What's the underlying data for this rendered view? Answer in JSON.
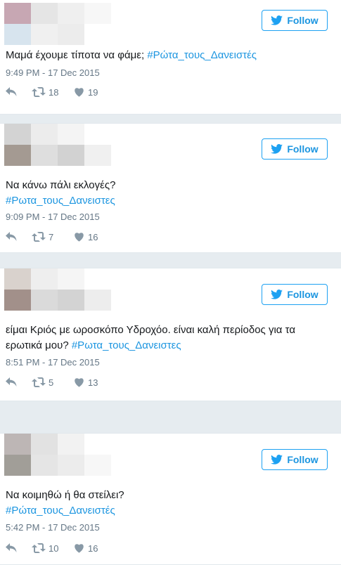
{
  "colors": {
    "accent": "#1da1f2",
    "link": "#1b95e0",
    "meta": "#657786",
    "icon": "#8899a6"
  },
  "tweets": [
    {
      "follow_label": "Follow",
      "text_plain": "Μαμά έχουμε τίποτα να φάμε; ",
      "hashtag": "#Ρώτα_τους_Δανειστές",
      "timestamp": "9:49 PM - 17 Dec 2015",
      "retweets": "18",
      "likes": "19",
      "avatar": [
        "#c7a7b3",
        "#e5e5e5",
        "#efefef",
        "#f7f7f7",
        "#d7e4ee",
        "#f0f0f0",
        "#ececec",
        "#ffffff"
      ]
    },
    {
      "follow_label": "Follow",
      "text_plain": "Να κάνω πάλι εκλογές?",
      "hashtag": "#Ρωτα_τους_Δανειστες",
      "timestamp": "9:09 PM - 17 Dec 2015",
      "retweets": "7",
      "likes": "16",
      "avatar": [
        "#d3d3d3",
        "#ececec",
        "#f4f4f4",
        "#ffffff",
        "#a49a92",
        "#dedede",
        "#d2d2d2",
        "#f0f0f0"
      ]
    },
    {
      "follow_label": "Follow",
      "text_plain": "είμαι Κριός με ωροσκόπο Υδροχόο. είναι καλή περίοδος για τα ερωτικά μου? ",
      "hashtag": "#Ρωτα_τους_Δανειστες",
      "timestamp": "8:51 PM - 17 Dec 2015",
      "retweets": "5",
      "likes": "13",
      "avatar": [
        "#d9d2cd",
        "#eeeeee",
        "#f5f5f5",
        "#ffffff",
        "#a2908a",
        "#dadada",
        "#d3d3d3",
        "#ededed"
      ]
    },
    {
      "follow_label": "Follow",
      "text_plain": "Να κοιμηθώ ή θα στείλει?",
      "hashtag": "#Ρώτα_τους_Δανειστές",
      "timestamp": "5:42 PM - 17 Dec 2015",
      "retweets": "10",
      "likes": "16",
      "avatar": [
        "#bdb6b5",
        "#e2e2e2",
        "#f2f2f2",
        "#ffffff",
        "#a19e98",
        "#e5e5e5",
        "#ececec",
        "#f7f7f7"
      ]
    }
  ]
}
